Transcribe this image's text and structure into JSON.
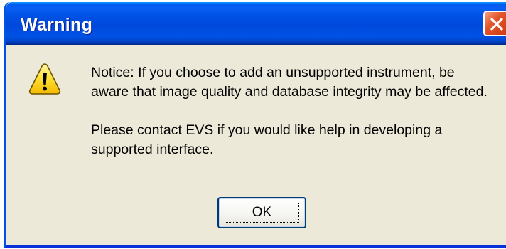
{
  "window": {
    "title": "Warning",
    "close_icon": "close-icon",
    "accent_color": "#0054e3",
    "close_color": "#e3552c"
  },
  "dialog": {
    "icon": "warning-icon",
    "message_lines": [
      "Notice: If you choose to add an unsupported instrument, be aware that image quality and database integrity may be affected.",
      "Please contact EVS if you would like help in developing a supported interface."
    ],
    "ok_label": "OK"
  }
}
